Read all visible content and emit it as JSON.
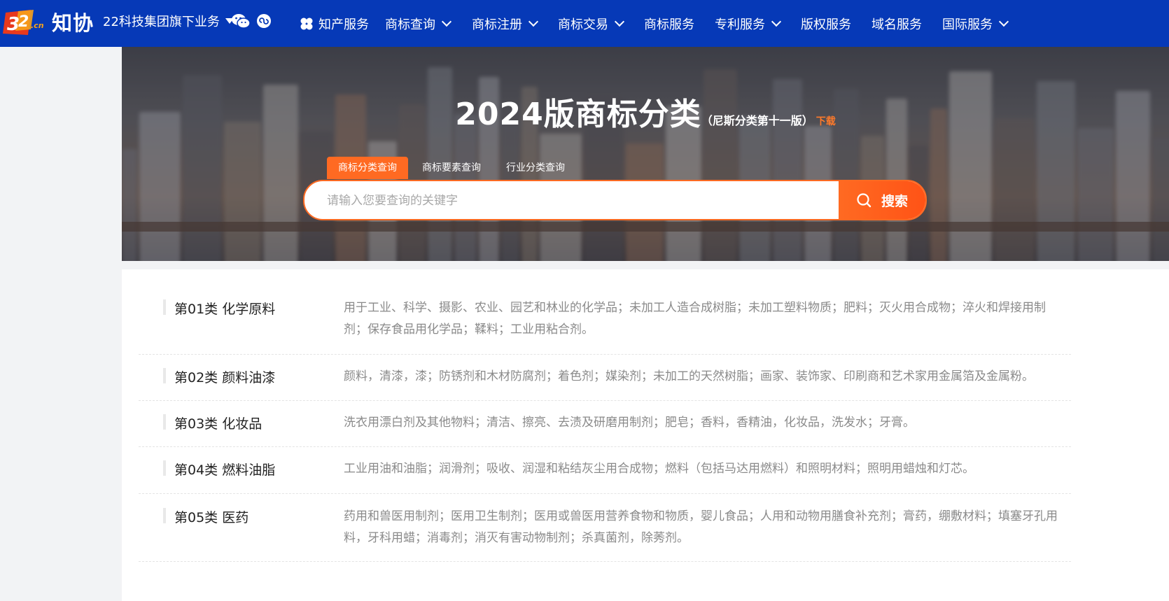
{
  "header": {
    "logo_text": "知协",
    "group_menu_label": "22科技集团旗下业务",
    "nav": [
      {
        "label": "知产服务",
        "dropdown": false,
        "icon": "clover-icon"
      },
      {
        "label": "商标查询",
        "dropdown": true
      },
      {
        "label": "商标注册",
        "dropdown": true
      },
      {
        "label": "商标交易",
        "dropdown": true
      },
      {
        "label": "商标服务",
        "dropdown": false
      },
      {
        "label": "专利服务",
        "dropdown": true
      },
      {
        "label": "版权服务",
        "dropdown": false
      },
      {
        "label": "域名服务",
        "dropdown": false
      },
      {
        "label": "国际服务",
        "dropdown": true
      }
    ]
  },
  "hero": {
    "title": "2024版商标分类",
    "subtitle": "（尼斯分类第十一版）",
    "download_label": "下载",
    "tabs": [
      {
        "label": "商标分类查询",
        "active": true
      },
      {
        "label": "商标要素查询",
        "active": false
      },
      {
        "label": "行业分类查询",
        "active": false
      }
    ],
    "search": {
      "placeholder": "请输入您要查询的关键字",
      "button_label": "搜索"
    }
  },
  "classes": [
    {
      "name": "第01类 化学原料",
      "desc": "用于工业、科学、摄影、农业、园艺和林业的化学品；未加工人造合成树脂；未加工塑料物质；肥料；灭火用合成物；淬火和焊接用制剂；保存食品用化学品；鞣料；工业用粘合剂。"
    },
    {
      "name": "第02类 颜料油漆",
      "desc": "颜料，清漆，漆；防锈剂和木材防腐剂；着色剂；媒染剂；未加工的天然树脂；画家、装饰家、印刷商和艺术家用金属箔及金属粉。"
    },
    {
      "name": "第03类 化妆品",
      "desc": "洗衣用漂白剂及其他物料；清洁、擦亮、去渍及研磨用制剂；肥皂；香料，香精油，化妆品，洗发水；牙膏。"
    },
    {
      "name": "第04类 燃料油脂",
      "desc": "工业用油和油脂；润滑剂；吸收、润湿和粘结灰尘用合成物；燃料（包括马达用燃料）和照明材料；照明用蜡烛和灯芯。"
    },
    {
      "name": "第05类 医药",
      "desc": "药用和兽医用制剂；医用卫生制剂；医用或兽医用营养食物和物质，婴儿食品；人用和动物用膳食补充剂；膏药，绷敷材料；填塞牙孔用料，牙科用蜡；消毒剂；消灭有害动物制剂；杀真菌剂，除莠剂。"
    }
  ],
  "colors": {
    "nav_bg": "#0639b7",
    "accent": "#ff6a22"
  }
}
